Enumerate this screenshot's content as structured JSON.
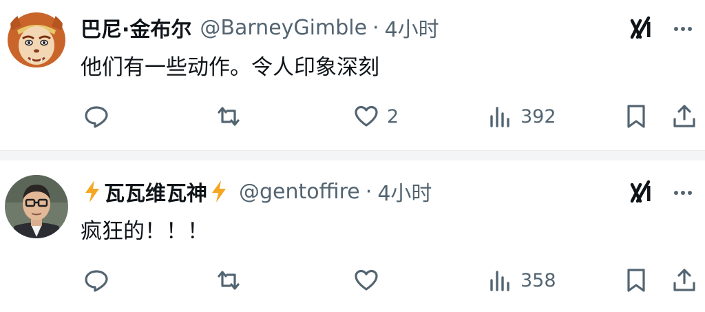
{
  "tweets": [
    {
      "display_name": "巴尼·金布尔",
      "handle": "@BarneyGimble",
      "separator": "·",
      "time": "4小时",
      "text": "他们有一些动作。令人印象深刻",
      "avatar": "monkey-king-avatar",
      "replies": "",
      "reposts": "",
      "likes": "2",
      "views": "392"
    },
    {
      "display_name": "瓦瓦维瓦神",
      "name_decoration": "lightning-bolt-icon",
      "handle": "@gentoffire",
      "separator": "·",
      "time": "4小时",
      "text": "疯狂的！！！",
      "avatar": "man-with-glasses-avatar",
      "replies": "",
      "reposts": "",
      "likes": "",
      "views": "358"
    }
  ],
  "icons": {
    "grok": "grok-icon",
    "more": "more-icon",
    "reply": "reply-icon",
    "repost": "repost-icon",
    "like": "like-icon",
    "views": "views-icon",
    "bookmark": "bookmark-icon",
    "share": "share-icon"
  },
  "colors": {
    "text_primary": "#0f1419",
    "text_secondary": "#536471",
    "bolt": "#f5a623",
    "divider": "#f4f5f6"
  }
}
